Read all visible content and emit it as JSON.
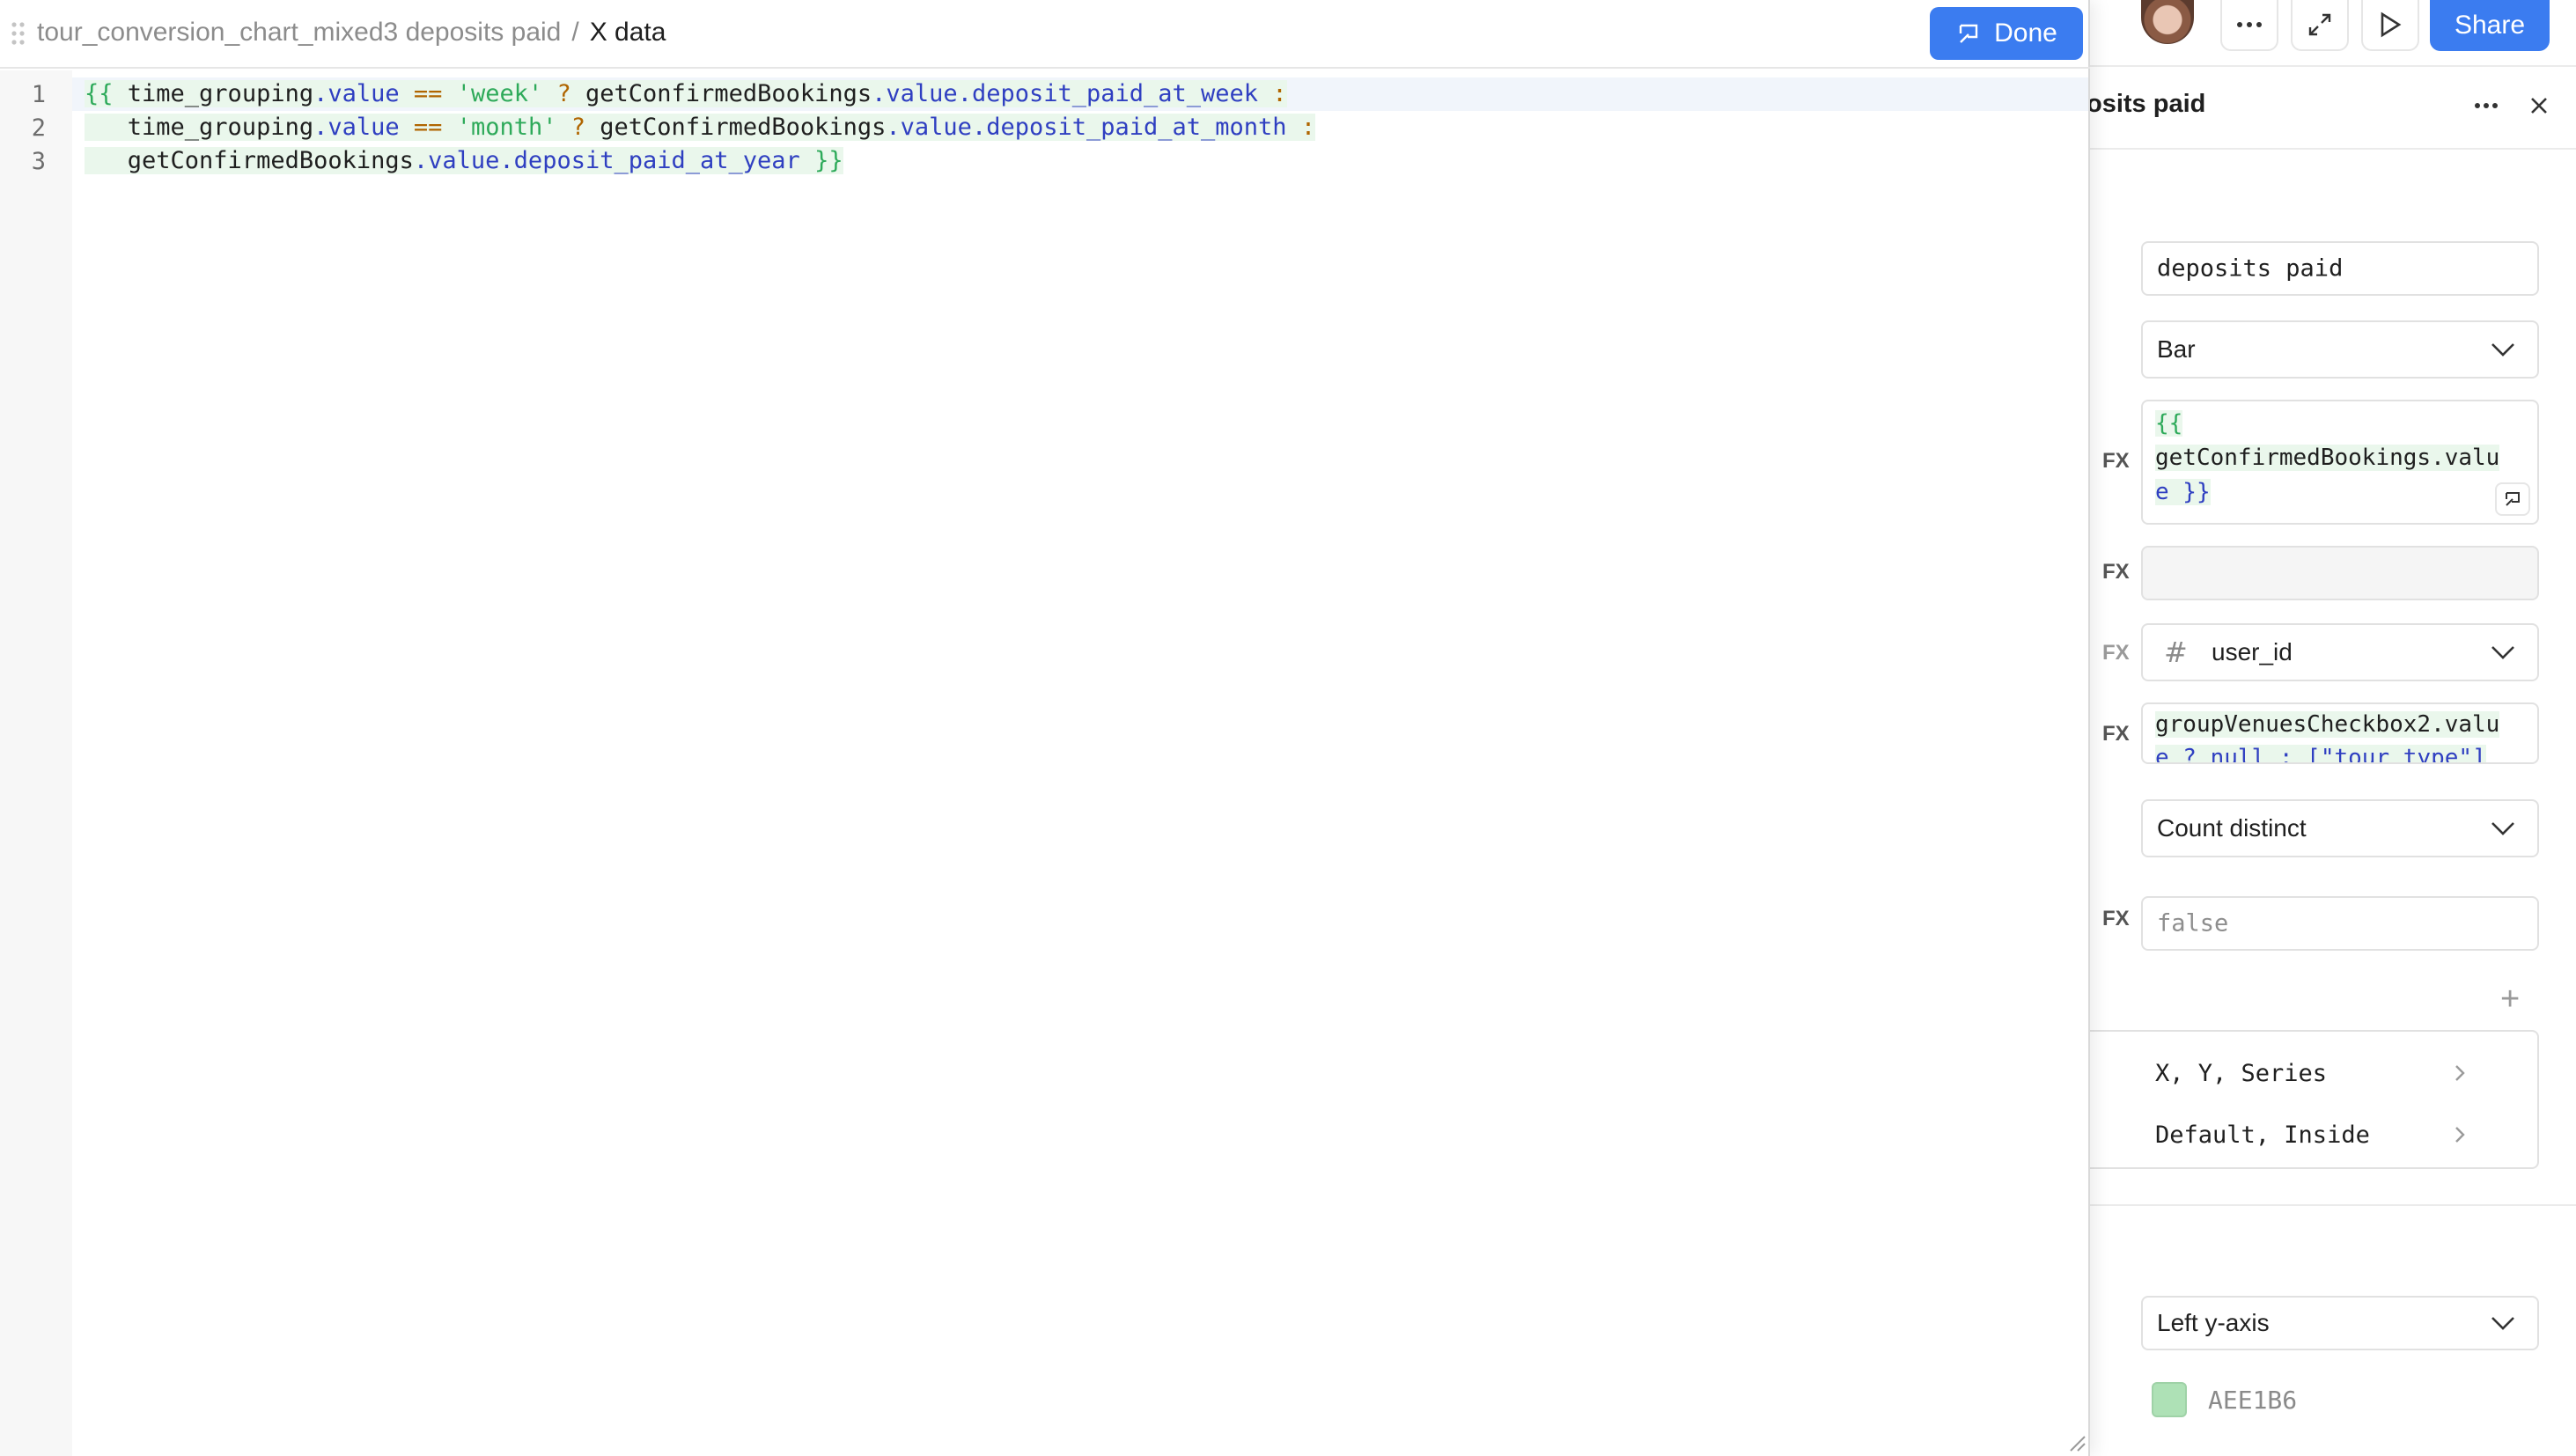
{
  "editor": {
    "breadcrumb": {
      "parent": "tour_conversion_chart_mixed3 deposits paid",
      "separator": "/",
      "current": "X data"
    },
    "done_label": "Done",
    "line_numbers": [
      "1",
      "2",
      "3"
    ],
    "code_lines": [
      "{{ time_grouping.value == 'week' ? getConfirmedBookings.value.deposit_paid_at_week :",
      "   time_grouping.value == 'month' ? getConfirmedBookings.value.deposit_paid_at_month :",
      "   getConfirmedBookings.value.deposit_paid_at_year }}"
    ]
  },
  "topbar": {
    "share_label": "Share"
  },
  "panel": {
    "title": "osits paid",
    "fx_label": "FX",
    "name_value": "deposits paid",
    "chart_type": "Bar",
    "data_source_lines": [
      "{{",
      "getConfirmedBookings.valu",
      "e }}"
    ],
    "x_axis_column": "user_id",
    "group_by_lines": [
      "groupVenuesCheckbox2.valu",
      "e ? null : [\"tour_type\"]"
    ],
    "aggregation": "Count distinct",
    "hidden_placeholder": "false",
    "group_rows": [
      "X, Y, Series",
      "Default, Inside"
    ],
    "axis": "Left y-axis",
    "color_hex": "AEE1B6"
  },
  "colors": {
    "accent": "#3b7cf0",
    "series_color": "#AEE1B6"
  }
}
